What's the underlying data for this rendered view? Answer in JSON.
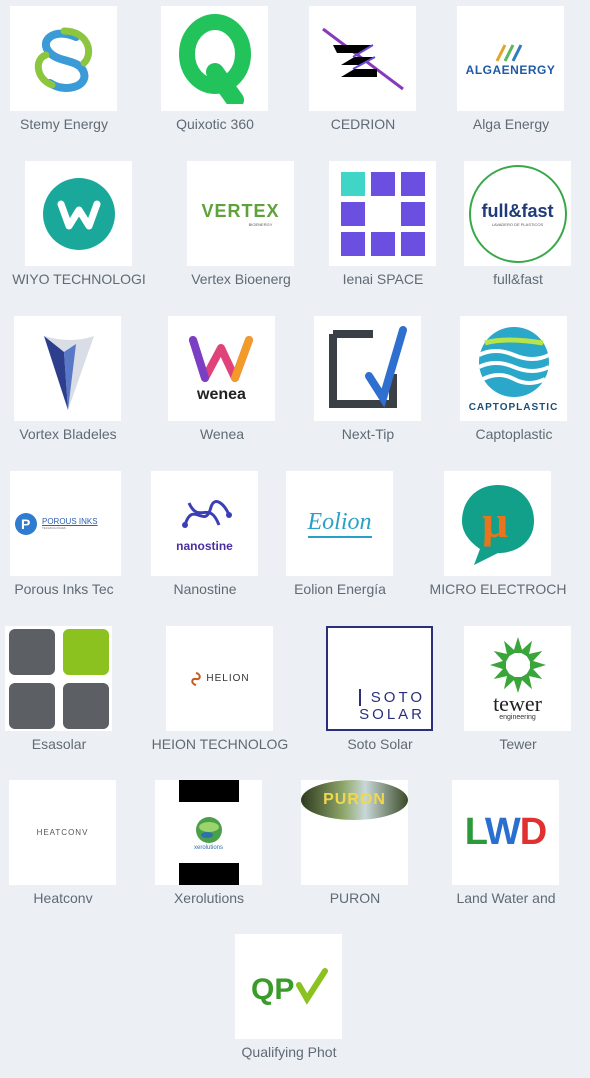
{
  "companies": [
    {
      "name": "Stemy Energy"
    },
    {
      "name": "Quixotic 360"
    },
    {
      "name": "CEDRION"
    },
    {
      "name": "Alga Energy",
      "logo_text": "ALGAENERGY"
    },
    {
      "name": "WIYO TECHNOLOGI"
    },
    {
      "name": "Vertex Bioenerg",
      "logo_text": "VERTEX",
      "logo_subtext": "BIOENERGY"
    },
    {
      "name": "Ienai SPACE"
    },
    {
      "name": "full&fast",
      "logo_text": "full&fast",
      "logo_subtext": "LAVADERO DE PLASTICOS"
    },
    {
      "name": "Vortex Bladeles"
    },
    {
      "name": "Wenea",
      "logo_text": "wenea"
    },
    {
      "name": "Next-Tip"
    },
    {
      "name": "Captoplastic",
      "logo_text": "CAPTOPLASTIC"
    },
    {
      "name": "Porous Inks Tec",
      "logo_text": "POROUS INKS",
      "logo_subtext": "TECHNOLOGIES"
    },
    {
      "name": "Nanostine",
      "logo_text": "nanostine"
    },
    {
      "name": "Eolion Energía",
      "logo_text": "Eolion"
    },
    {
      "name": "MICRO ELECTROCH",
      "logo_text": "μ"
    },
    {
      "name": "Esasolar"
    },
    {
      "name": "HEION TECHNOLOG",
      "logo_text": "HELION"
    },
    {
      "name": "Soto Solar",
      "logo_text": "SOTO",
      "logo_subtext": "SOLAR"
    },
    {
      "name": "Tewer",
      "logo_text": "tewer",
      "logo_subtext": "engineering"
    },
    {
      "name": "Heatconv",
      "logo_text": "HEATCONV"
    },
    {
      "name": "Xerolutions",
      "logo_text": "xerolutions"
    },
    {
      "name": "PURON",
      "logo_text": "PURON"
    },
    {
      "name": "Land Water and",
      "logo_text": "LWD"
    },
    {
      "name": "Qualifying Phot",
      "logo_text": "QPV"
    }
  ]
}
